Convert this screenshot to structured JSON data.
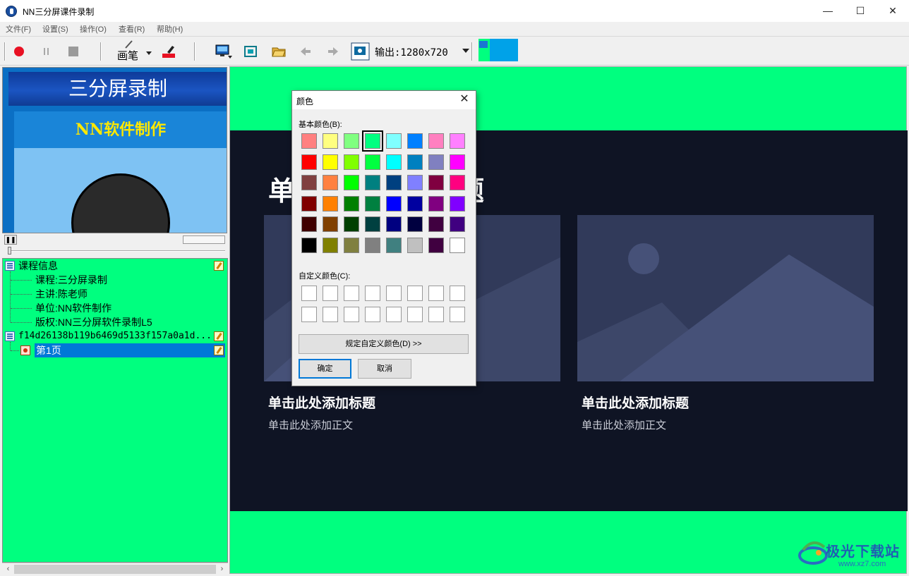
{
  "window": {
    "title": "NN三分屏课件录制",
    "minimize": "—",
    "maximize": "☐",
    "close": "✕"
  },
  "menu": [
    "文件(F)",
    "设置(S)",
    "操作(O)",
    "查看(R)",
    "帮助(H)"
  ],
  "toolbar": {
    "pen_label": "画笔",
    "output_label": "输出:1280x720",
    "record_color": "#e81123",
    "accent_swatch": "#00a2e8"
  },
  "preview": {
    "banner_text": "三分屏录制",
    "subtitle_text": "NN软件制作"
  },
  "tree": {
    "course_root": "课程信息",
    "course_items": [
      "课程:三分屏录制",
      "主讲:陈老师",
      "单位:NN软件制作",
      "版权:NN三分屏软件录制L5"
    ],
    "file_node": "f14d26138b119b6469d5133f157a0a1d...",
    "page_node": "第1页"
  },
  "slide": {
    "title": "单击此处添加标题",
    "title_hidden_prefix": "单",
    "title_hidden_suffix": "题",
    "captions": [
      {
        "title": "单击此处添加标题",
        "body": "单击此处添加正文"
      },
      {
        "title": "单击此处添加标题",
        "body": "单击此处添加正文"
      }
    ]
  },
  "dialog": {
    "title": "颜色",
    "basic_label": "基本颜色(B):",
    "custom_label": "自定义颜色(C):",
    "define_button": "规定自定义颜色(D) >>",
    "ok": "确定",
    "cancel": "取消",
    "selected_index": 3,
    "basic_colors": [
      "#ff8080",
      "#ffff80",
      "#80ff80",
      "#00ff80",
      "#80ffff",
      "#0080ff",
      "#ff80c0",
      "#ff80ff",
      "#ff0000",
      "#ffff00",
      "#80ff00",
      "#00ff40",
      "#00ffff",
      "#0080c0",
      "#8080c0",
      "#ff00ff",
      "#804040",
      "#ff8040",
      "#00ff00",
      "#008080",
      "#004080",
      "#8080ff",
      "#800040",
      "#ff0080",
      "#800000",
      "#ff8000",
      "#008000",
      "#008040",
      "#0000ff",
      "#0000a0",
      "#800080",
      "#8000ff",
      "#400000",
      "#804000",
      "#004000",
      "#004040",
      "#000080",
      "#000040",
      "#400040",
      "#400080",
      "#000000",
      "#808000",
      "#808040",
      "#808080",
      "#408080",
      "#c0c0c0",
      "#400040",
      "#ffffff"
    ],
    "custom_count": 16
  },
  "watermark": {
    "name": "极光下载站",
    "url": "www.xz7.com"
  },
  "colors": {
    "canvas_green": "#00ff7f",
    "slide_bg": "#0f1424",
    "placeholder": "#313a5a",
    "selection": "#0078d7"
  }
}
